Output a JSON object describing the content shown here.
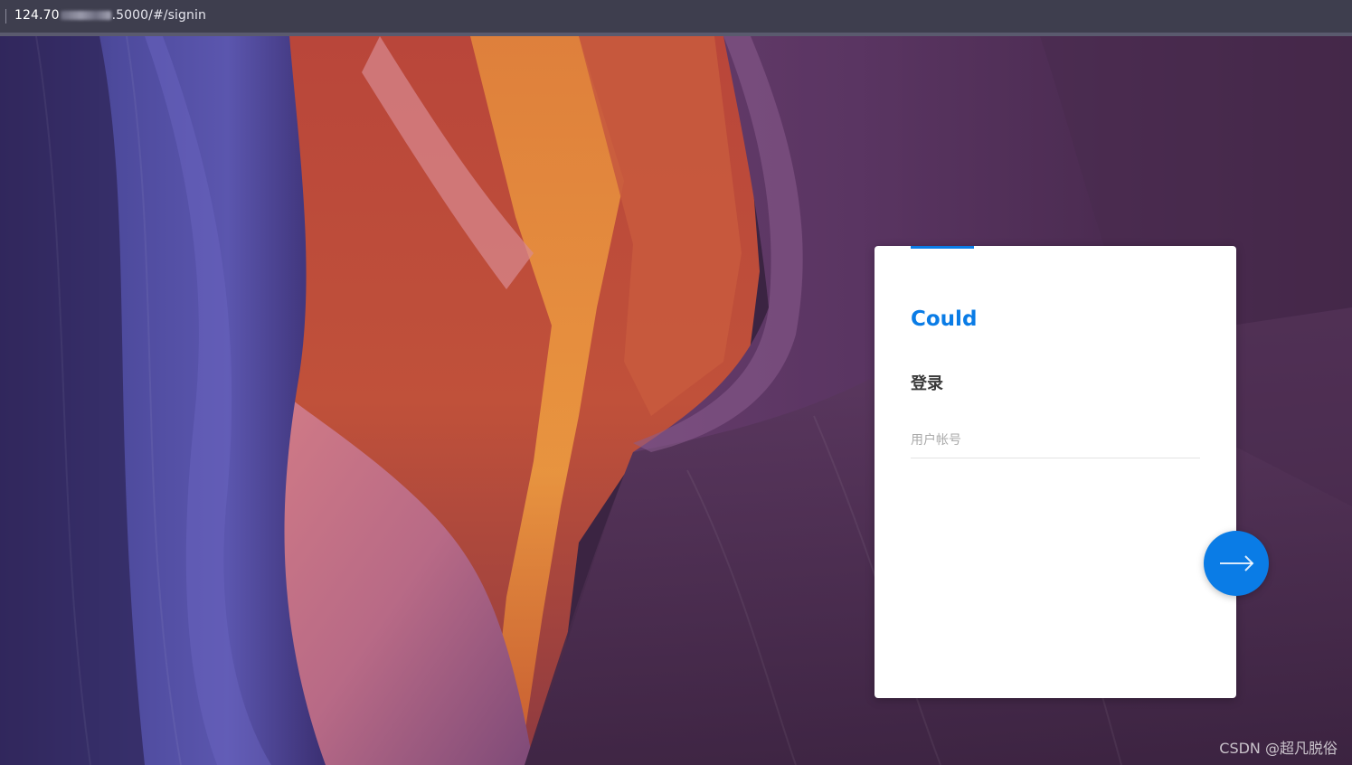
{
  "browser": {
    "url_visible_start": "124.70",
    "url_visible_end": ".5000/#/signin"
  },
  "login": {
    "brand": "Could",
    "title": "登录",
    "username_placeholder": "用户帐号"
  },
  "submit": {
    "icon": "arrow-right-icon"
  },
  "watermark": "CSDN @超凡脱俗",
  "colors": {
    "accent": "#0a7ce6",
    "card": "#ffffff",
    "browser_bar": "#3e3e4e"
  }
}
